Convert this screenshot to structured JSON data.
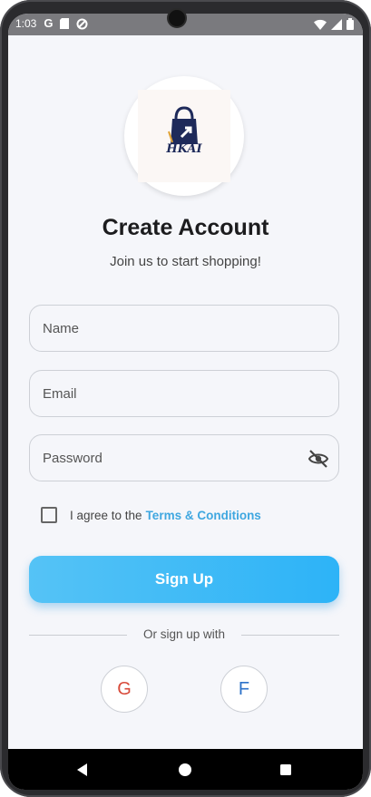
{
  "status_bar": {
    "time": "1:03",
    "icons": [
      "google-icon",
      "sd-card-icon",
      "sync-icon",
      "wifi-icon",
      "signal-icon",
      "battery-icon"
    ]
  },
  "logo": {
    "text": "HKAI",
    "icon": "shopping-bag-icon"
  },
  "header": {
    "title": "Create Account",
    "subtitle": "Join us to start shopping!"
  },
  "form": {
    "name_placeholder": "Name",
    "email_placeholder": "Email",
    "password_placeholder": "Password",
    "password_toggle_icon": "eye-off-icon"
  },
  "terms": {
    "text": "I agree to the",
    "link": "Terms & Conditions",
    "checked": false
  },
  "signup_button": {
    "label": "Sign Up"
  },
  "divider": {
    "text": "Or sign up with"
  },
  "social": {
    "google_label": "G",
    "facebook_label": "F"
  },
  "colors": {
    "accent": "#2db3f7",
    "link": "#3fa7e0",
    "background": "#f5f6fa",
    "google": "#d84a3a",
    "facebook": "#2d72c9",
    "logo_navy": "#1e2a5a"
  }
}
